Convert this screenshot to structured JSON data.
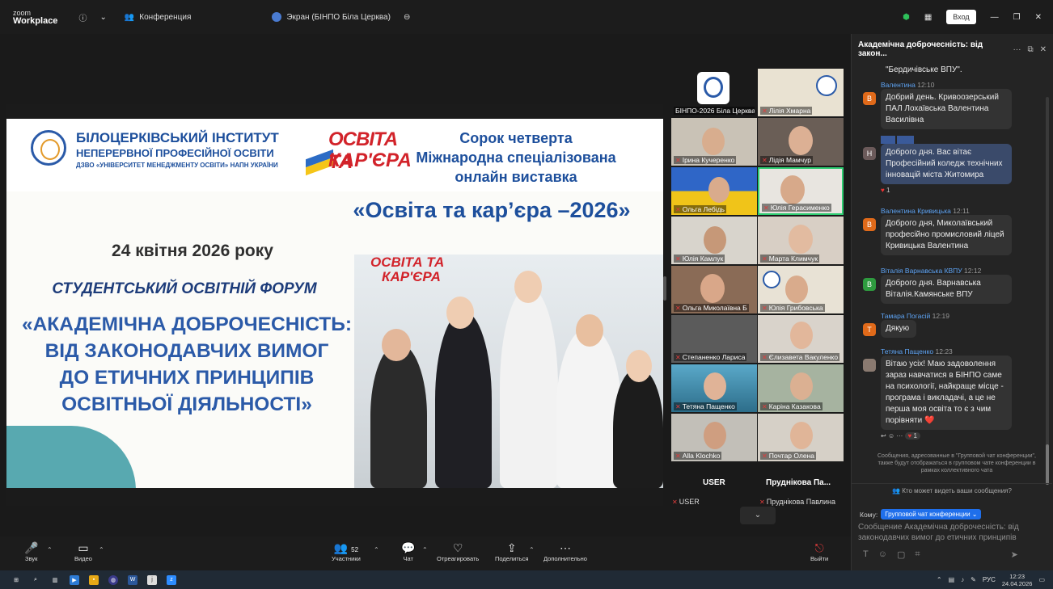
{
  "titlebar": {
    "logo_top": "zoom",
    "logo_bottom": "Workplace",
    "meeting_label": "Конференция",
    "screen_label": "Экран (БІНПО Біла Церква)",
    "signin": "Вход"
  },
  "slide": {
    "inst_line1": "БІЛОЦЕРКІВСЬКИЙ ІНСТИТУТ",
    "inst_line2": "НЕПЕРЕРВНОЇ ПРОФЕСІЙНОЇ ОСВІТИ",
    "inst_line3": "ДЗВО «УНІВЕРСИТЕТ МЕНЕДЖМЕНТУ ОСВІТИ» НАПН УКРАЇНИ",
    "brand_top": "ОСВІТА ТА",
    "brand_bottom": "КАР'ЄРА",
    "expo_line1": "Сорок четверта",
    "expo_line2": "Міжнародна спеціалізована",
    "expo_line3": "онлайн виставка",
    "expo_title": "«Освіта та кар’єра –2026»",
    "date": "24 квітня 2026 року",
    "forum": "СТУДЕНТСЬКИЙ ОСВІТНІЙ ФОРУМ",
    "theme_l1": "«АКАДЕМІЧНА ДОБРОЧЕСНІСТЬ:",
    "theme_l2": "ВІД ЗАКОНОДАВЧИХ ВИМОГ",
    "theme_l3": "ДО ЕТИЧНИХ ПРИНЦИПІВ",
    "theme_l4": "ОСВІТНЬОЇ ДІЯЛЬНОСТІ»",
    "photo_brand_top": "ОСВІТА ТА",
    "photo_brand_bottom": "КАР'ЄРА"
  },
  "gallery": {
    "tiles": [
      "БІНПО-2026 Біла Церква",
      "Лілія Хмарна",
      "Ірина Кучеренко",
      "Лідія Мамчур",
      "Ольга Лебідь",
      "Юлія Герасименко",
      "Юлія Камлук",
      "Марта Климчук",
      "Ольга Миколаївна Б",
      "Юлія Грибовська",
      "Степаненко Лариса",
      "Єлизавета Вакуленко",
      "Тетяна Пащенко",
      "Каріна Казакова",
      "Alla Klochko",
      "Почтар Олена"
    ],
    "user1_title": "USER",
    "user1_name": "USER",
    "user2_title": "Пруднікова Па...",
    "user2_name": "Пруднікова Павлина"
  },
  "chat": {
    "title": "Академічна доброчесність: від закон...",
    "messages": [
      {
        "sender": "",
        "time": "",
        "text": "\"Бердичівське ВПУ\".",
        "avatar": ""
      },
      {
        "sender": "Валентина",
        "time": "12:10",
        "text": "Добрий день. Кривоозерський ПАЛ Лохаївська Валентина Василівна",
        "avatar": "В"
      },
      {
        "sender": "",
        "time": "",
        "text": "Доброго дня. Вас вітає Професійний коледж технічних інновацій міста Житомира",
        "avatar": "Н"
      },
      {
        "sender": "Валентина Кривицька",
        "time": "12:11",
        "text": "Доброго дня, Миколаївський професійно промисловий ліцей Кривицька Валентина",
        "avatar": "В"
      },
      {
        "sender": "Віталія Варнавська КВПУ",
        "time": "12:12",
        "text": "Доброго дня. Варнавська Віталія.Камянське ВПУ",
        "avatar": "В"
      },
      {
        "sender": "Тамара Погасій",
        "time": "12:19",
        "text": "Дякую",
        "avatar": "Т"
      },
      {
        "sender": "Тетяна Пащенко",
        "time": "12:23",
        "text": "Вітаю усіх! Маю задоволення зараз навчатися в БІНПО саме на психології, найкраще місце - програма і викладачі, а це не перша моя освіта то є з чим порівняти ❤️",
        "avatar": ""
      }
    ],
    "reaction_count": "1",
    "reaction_count2": "1",
    "note": "Сообщения, адресованные в \"Групповой чат конференции\", также будут отображаться в групповом чате конференции в рамках коллективного чата",
    "who_sees": "Кто может видеть ваши сообщения?",
    "to_label": "Кому:",
    "to_target": "Групповой чат конференции",
    "input_placeholder": "Сообщение Академічна доброчесність: від законодавчих вимог до етичних принципів"
  },
  "toolbar": {
    "audio": "Звук",
    "video": "Видео",
    "participants": "Участники",
    "participants_count": "52",
    "chat": "Чат",
    "react": "Отреагировать",
    "share": "Поделиться",
    "more": "Дополнительно",
    "leave": "Выйти"
  },
  "taskbar": {
    "lang": "РУС",
    "time": "12:23",
    "date": "24.04.2026"
  },
  "colors": {
    "accent": "#1f6feb",
    "brand_blue": "#1d4f9c",
    "brand_red": "#d2232a"
  }
}
